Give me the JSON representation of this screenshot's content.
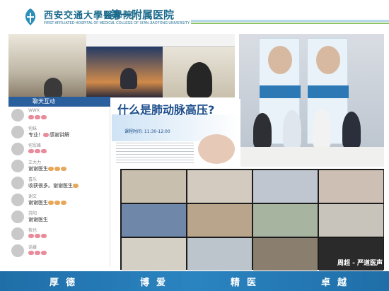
{
  "header": {
    "school_name_cn": "西安交通大學醫學院",
    "hospital_name_cn": "第一附属医院",
    "school_name_en": "FIRST AFFILIATED HOSPITAL OF MEDICAL COLLEGE OF XI'AN JIAOTONG UNIVERSITY"
  },
  "chat": {
    "title": "聊天互动",
    "messages": [
      {
        "name": "WWX",
        "text": "",
        "emoji": "heart",
        "count": 3
      },
      {
        "name": "何妹",
        "text": "专业！",
        "tail": "感谢讲解",
        "emoji": "heart",
        "count": 1
      },
      {
        "name": "何军峰",
        "text": "",
        "emoji": "heart",
        "count": 3
      },
      {
        "name": "王大力",
        "text": "谢谢医生",
        "emoji": "clap",
        "count": 3
      },
      {
        "name": "喜乐",
        "text": "收获很多。谢谢医生",
        "emoji": "smile",
        "count": 1
      },
      {
        "name": "谢文",
        "text": "谢谢医生",
        "emoji": "clap",
        "count": 3
      },
      {
        "name": "苏阳",
        "text": "谢谢医生",
        "emoji": "",
        "count": 0
      },
      {
        "name": "我也",
        "text": "",
        "emoji": "heart",
        "count": 3
      },
      {
        "name": "话媛",
        "text": "",
        "emoji": "heart",
        "count": 3
      }
    ]
  },
  "slide": {
    "title": "什么是肺动脉高压?",
    "time": "课程时间: 11:30-12:00"
  },
  "grid": {
    "watermark": "周超 - 严道医声"
  },
  "motto": [
    "厚德",
    "博爱",
    "精医",
    "卓越"
  ],
  "colors": {
    "brand_blue": "#1b6a8c",
    "motto_bar": "#2a84c0",
    "chat_header": "#2a5f9e"
  }
}
